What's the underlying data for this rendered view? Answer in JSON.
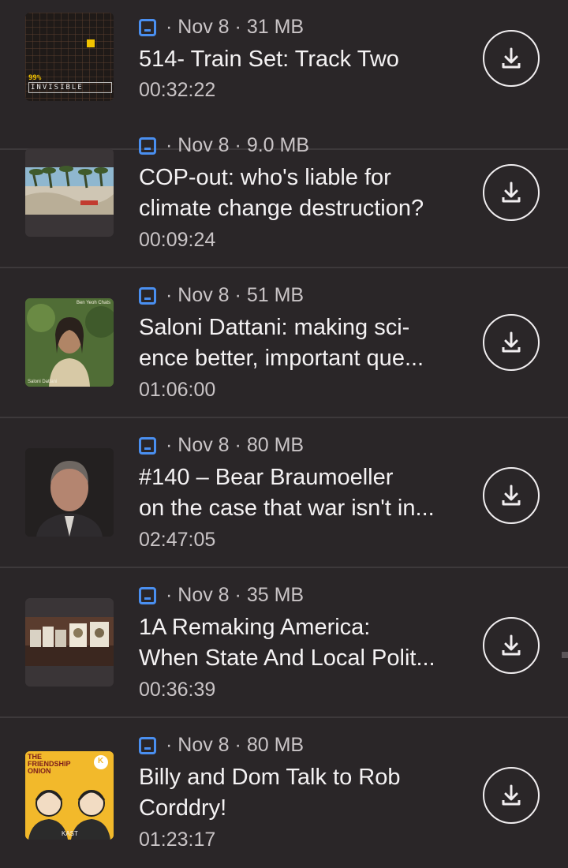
{
  "episodes": [
    {
      "date": "Nov 8",
      "size": "31 MB",
      "title_lines": [
        "514- Train Set: Track Two"
      ],
      "duration": "00:32:22",
      "art_text": [
        "99%",
        "INVISIBLE"
      ]
    },
    {
      "date": "Nov 8",
      "size": "9.0 MB",
      "title_lines": [
        "COP-out: who's liable for",
        "climate change destruction?"
      ],
      "duration": "00:09:24"
    },
    {
      "date": "Nov 8",
      "size": "51 MB",
      "title_lines": [
        "Saloni Dattani: making sci-",
        "ence better, important que..."
      ],
      "duration": "01:06:00",
      "art_text": [
        "Ben Yeoh Chats",
        "Saloni Dattani"
      ]
    },
    {
      "date": "Nov 8",
      "size": "80 MB",
      "title_lines": [
        "#140 – Bear Braumoeller",
        "on the case that war isn't in..."
      ],
      "duration": "02:47:05"
    },
    {
      "date": "Nov 8",
      "size": "35 MB",
      "title_lines": [
        "1A Remaking America:",
        "When State And Local Polit..."
      ],
      "duration": "00:36:39"
    },
    {
      "date": "Nov 8",
      "size": "80 MB",
      "title_lines": [
        "Billy and Dom Talk to Rob",
        "Corddry!"
      ],
      "duration": "01:23:17",
      "art_text": [
        "THE",
        "FRIENDSHIP",
        "ONION",
        "KAST",
        "K"
      ]
    }
  ],
  "separator": "·",
  "icons": {
    "queue": "queue-icon",
    "download": "download-icon"
  },
  "colors": {
    "background": "#2a2626",
    "accent": "#4a8ff0",
    "text": "#f4f2f3",
    "muted": "#c9c4c6"
  }
}
